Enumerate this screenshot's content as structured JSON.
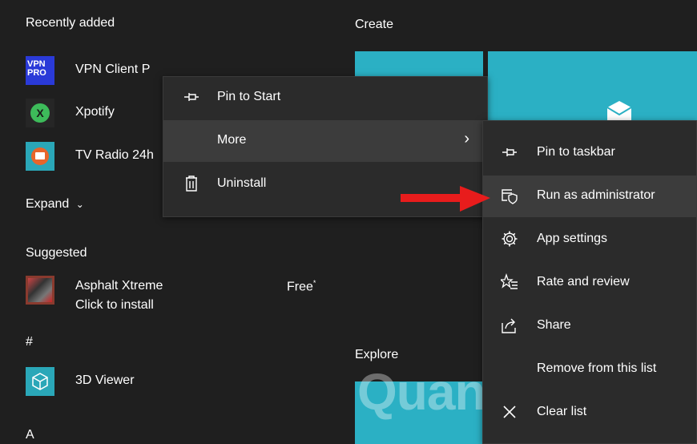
{
  "left": {
    "recently_added_title": "Recently added",
    "apps_recent": [
      {
        "label": "VPN Client P",
        "icon": "vpn-pro-icon",
        "tile_text": "VPN PRO"
      },
      {
        "label": "Xpotify",
        "icon": "xpotify-icon",
        "tile_text": "X"
      },
      {
        "label": "TV Radio 24h",
        "icon": "tv-radio-icon"
      }
    ],
    "expand_label": "Expand",
    "suggested_title": "Suggested",
    "suggested_app": {
      "label": "Asphalt Xtreme",
      "sublabel": "Click to install",
      "price": "Free",
      "price_mark": "*"
    },
    "hash_header": "#",
    "viewer_label": "3D Viewer",
    "a_header": "A"
  },
  "right": {
    "create_title": "Create",
    "explore_title": "Explore"
  },
  "context_menu": {
    "items": [
      {
        "label": "Pin to Start",
        "icon": "pin-icon"
      },
      {
        "label": "More",
        "icon": "",
        "has_submenu": true
      },
      {
        "label": "Uninstall",
        "icon": "trash-icon"
      }
    ]
  },
  "submenu": {
    "items": [
      {
        "label": "Pin to taskbar",
        "icon": "pin-icon"
      },
      {
        "label": "Run as administrator",
        "icon": "shield-window-icon"
      },
      {
        "label": "App settings",
        "icon": "gear-icon"
      },
      {
        "label": "Rate and review",
        "icon": "star-list-icon"
      },
      {
        "label": "Share",
        "icon": "share-icon"
      },
      {
        "label": "Remove from this list",
        "icon": ""
      },
      {
        "label": "Clear list",
        "icon": "close-icon"
      }
    ]
  },
  "watermark_text": "Quantrimang",
  "colors": {
    "background": "#1f1f1f",
    "menu": "#2b2b2b",
    "menu_hover": "#3c3c3c",
    "tile": "#2bb0c4",
    "arrow": "#e81c1c"
  }
}
